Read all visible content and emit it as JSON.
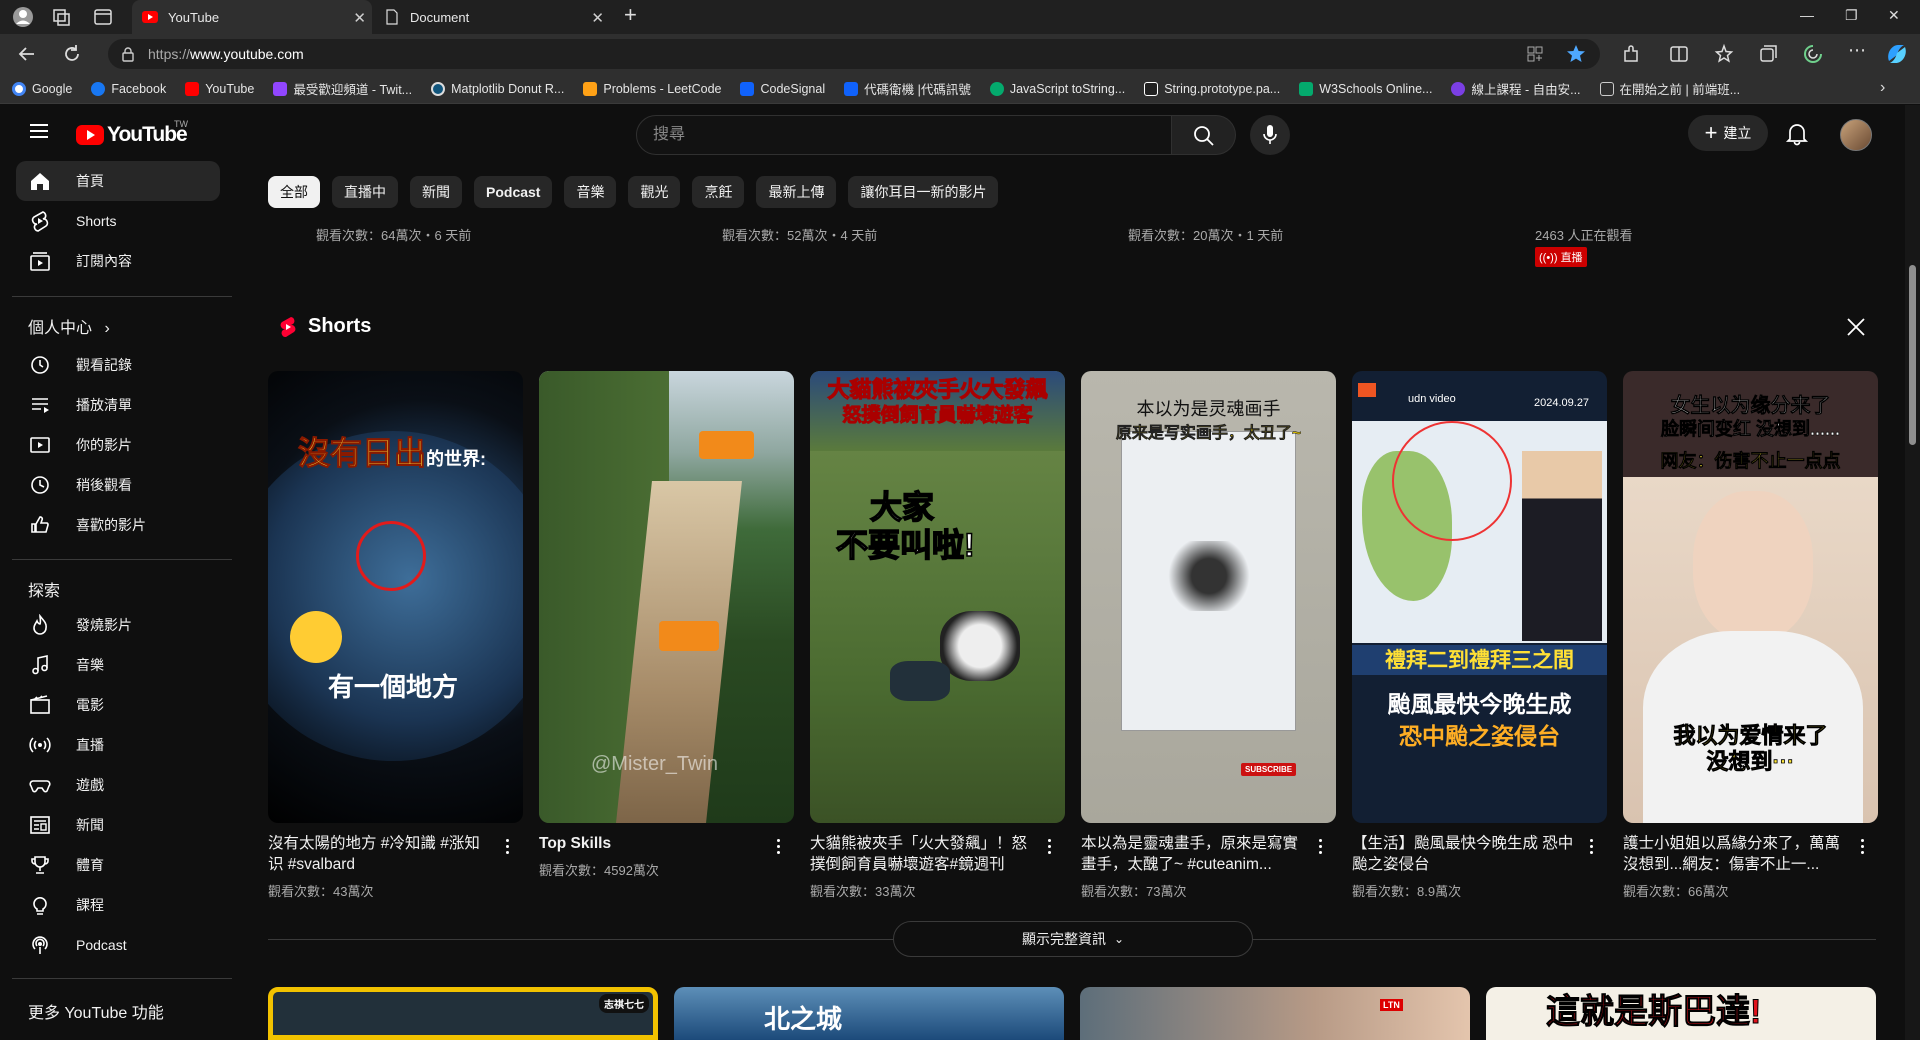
{
  "browser": {
    "tabs": [
      {
        "title": "YouTube",
        "active": true
      },
      {
        "title": "Document",
        "active": false
      }
    ],
    "url_prefix": "https://",
    "url_host": "www.youtube.com",
    "bookmarks": [
      {
        "label": "Google",
        "color": "#4285f4"
      },
      {
        "label": "Facebook",
        "color": "#1877f2"
      },
      {
        "label": "YouTube",
        "color": "#ff0000"
      },
      {
        "label": "最受歡迎頻道 - Twit...",
        "color": "#9146ff"
      },
      {
        "label": "Matplotlib Donut R...",
        "color": "#11557c"
      },
      {
        "label": "Problems - LeetCode",
        "color": "#ffa116"
      },
      {
        "label": "CodeSignal",
        "color": "#1062fb"
      },
      {
        "label": "代碼衛機 |代碼訊號",
        "color": "#1062fb"
      },
      {
        "label": "JavaScript toString...",
        "color": "#04aa6d"
      },
      {
        "label": "String.prototype.pa...",
        "color": "#ffffff"
      },
      {
        "label": "W3Schools Online...",
        "color": "#04aa6d"
      },
      {
        "label": "線上課程 - 自由安...",
        "color": "#7b3fe4"
      },
      {
        "label": "在開始之前 | 前端班...",
        "color": "#cccccc"
      }
    ]
  },
  "masthead": {
    "logo_text": "YouTube",
    "country_code": "TW",
    "search_placeholder": "搜尋",
    "create_label": "建立"
  },
  "sidebar": {
    "main": [
      {
        "label": "首頁",
        "icon": "home-icon",
        "active": true
      },
      {
        "label": "Shorts",
        "icon": "shorts-icon"
      },
      {
        "label": "訂閱內容",
        "icon": "subscriptions-icon"
      }
    ],
    "you_header": "個人中心",
    "you": [
      {
        "label": "觀看記錄",
        "icon": "history-icon"
      },
      {
        "label": "播放清單",
        "icon": "playlists-icon"
      },
      {
        "label": "你的影片",
        "icon": "your-videos-icon"
      },
      {
        "label": "稍後觀看",
        "icon": "watch-later-icon"
      },
      {
        "label": "喜歡的影片",
        "icon": "liked-videos-icon"
      }
    ],
    "explore_header": "探索",
    "explore": [
      {
        "label": "發燒影片",
        "icon": "trending-icon"
      },
      {
        "label": "音樂",
        "icon": "music-icon"
      },
      {
        "label": "電影",
        "icon": "movies-icon"
      },
      {
        "label": "直播",
        "icon": "live-icon"
      },
      {
        "label": "遊戲",
        "icon": "gaming-icon"
      },
      {
        "label": "新聞",
        "icon": "news-icon"
      },
      {
        "label": "體育",
        "icon": "sports-icon"
      },
      {
        "label": "課程",
        "icon": "courses-icon"
      },
      {
        "label": "Podcast",
        "icon": "podcast-icon"
      }
    ],
    "more_header": "更多 YouTube 功能"
  },
  "chips": [
    "全部",
    "直播中",
    "新聞",
    "Podcast",
    "音樂",
    "觀光",
    "烹飪",
    "最新上傳",
    "讓你耳目一新的影片"
  ],
  "prev_row": [
    "觀看次數：64萬次・6 天前",
    "觀看次數：52萬次・4 天前",
    "觀看次數：20萬次・1 天前",
    "2463 人正在觀看"
  ],
  "live_badge": "直播",
  "shorts": {
    "title": "Shorts",
    "items": [
      {
        "title": "沒有太陽的地方 #冷知識 #涨知识 #svalbard",
        "views": "觀看次數：43萬次",
        "overlay": {
          "main": "沒有日出",
          "suffix": "的世界:",
          "bottom": "有一個地方"
        }
      },
      {
        "title": "Top Skills",
        "views": "觀看次數：4592萬次",
        "overlay": {
          "watermark": "@Mister_Twin"
        }
      },
      {
        "title": "大貓熊被夾手「火大發飆」！怒撲倒飼育員嚇壞遊客#鏡週刊",
        "views": "觀看次數：33萬次",
        "overlay": {
          "top": "大貓熊被夾手火大發飆",
          "top2": "怒撲倒飼育員嚇壞遊客",
          "mid1": "大家",
          "mid2": "不要叫啦!"
        }
      },
      {
        "title": "本以為是靈魂畫手，原來是寫實畫手，太醜了~ #cuteanim...",
        "views": "觀看次數：73萬次",
        "overlay": {
          "line1": "本以为是灵魂画手",
          "line2": "原来是写实画手，太丑了~",
          "badge": "SUBSCRIBE"
        }
      },
      {
        "title": "【生活】颱風最快今晚生成 恐中颱之姿侵台",
        "views": "觀看次數：8.9萬次",
        "overlay": {
          "brand": "udn video",
          "date": "2024.09.27",
          "band": "禮拜二到禮拜三之間",
          "line1": "颱風最快今晚生成",
          "line2": "恐中颱之姿侵台"
        }
      },
      {
        "title": "護士小姐姐以爲緣分來了，萬萬沒想到...網友：傷害不止一...",
        "views": "觀看次數：66萬次",
        "overlay": {
          "line1": "女生以为缘分来了",
          "line2": "脸瞬间变红 没想到......",
          "line3": "网友：伤害不止一点点",
          "bottom1": "我以为爱情来了",
          "bottom2": "没想到···"
        }
      }
    ]
  },
  "show_more_label": "顯示完整資訊",
  "bottom_row": [
    {
      "overlay": "志祺七七",
      "bg": "#f2c200"
    },
    {
      "overlay": "北之城",
      "bg": "#1c4a7a"
    },
    {
      "overlay": "LTN",
      "bg": "#6a6a6a"
    },
    {
      "overlay": "這就是斯巴達!",
      "bg": "#f4f0e6"
    }
  ]
}
